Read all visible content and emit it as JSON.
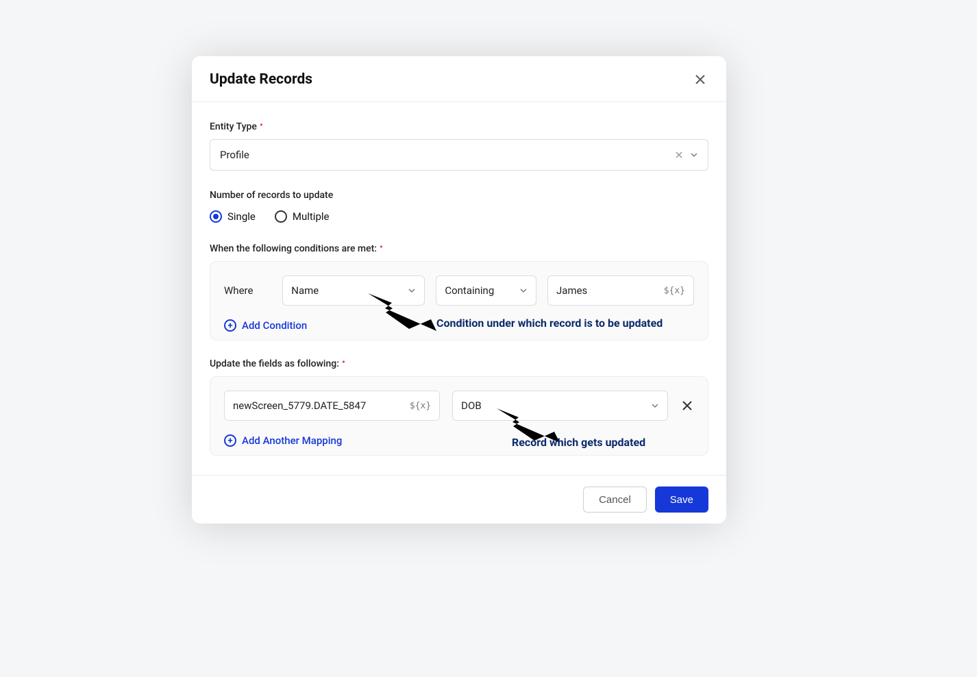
{
  "modal": {
    "title": "Update Records"
  },
  "entity": {
    "label": "Entity Type",
    "value": "Profile"
  },
  "records": {
    "label": "Number of records to update",
    "single": "Single",
    "multiple": "Multiple",
    "selected": "single"
  },
  "conditions": {
    "label": "When the following conditions are met:",
    "where": "Where",
    "field": "Name",
    "op": "Containing",
    "value": "James",
    "add": "Add Condition",
    "var_icon": "${x}"
  },
  "mapping": {
    "label": "Update the fields as following:",
    "source_value": "newScreen_5779.DATE_5847",
    "target_value": "DOB",
    "add": "Add Another Mapping",
    "var_icon": "${x}"
  },
  "annotations": {
    "condition": "Condition under which record is to be updated",
    "record": "Record which gets updated"
  },
  "footer": {
    "cancel": "Cancel",
    "save": "Save"
  }
}
